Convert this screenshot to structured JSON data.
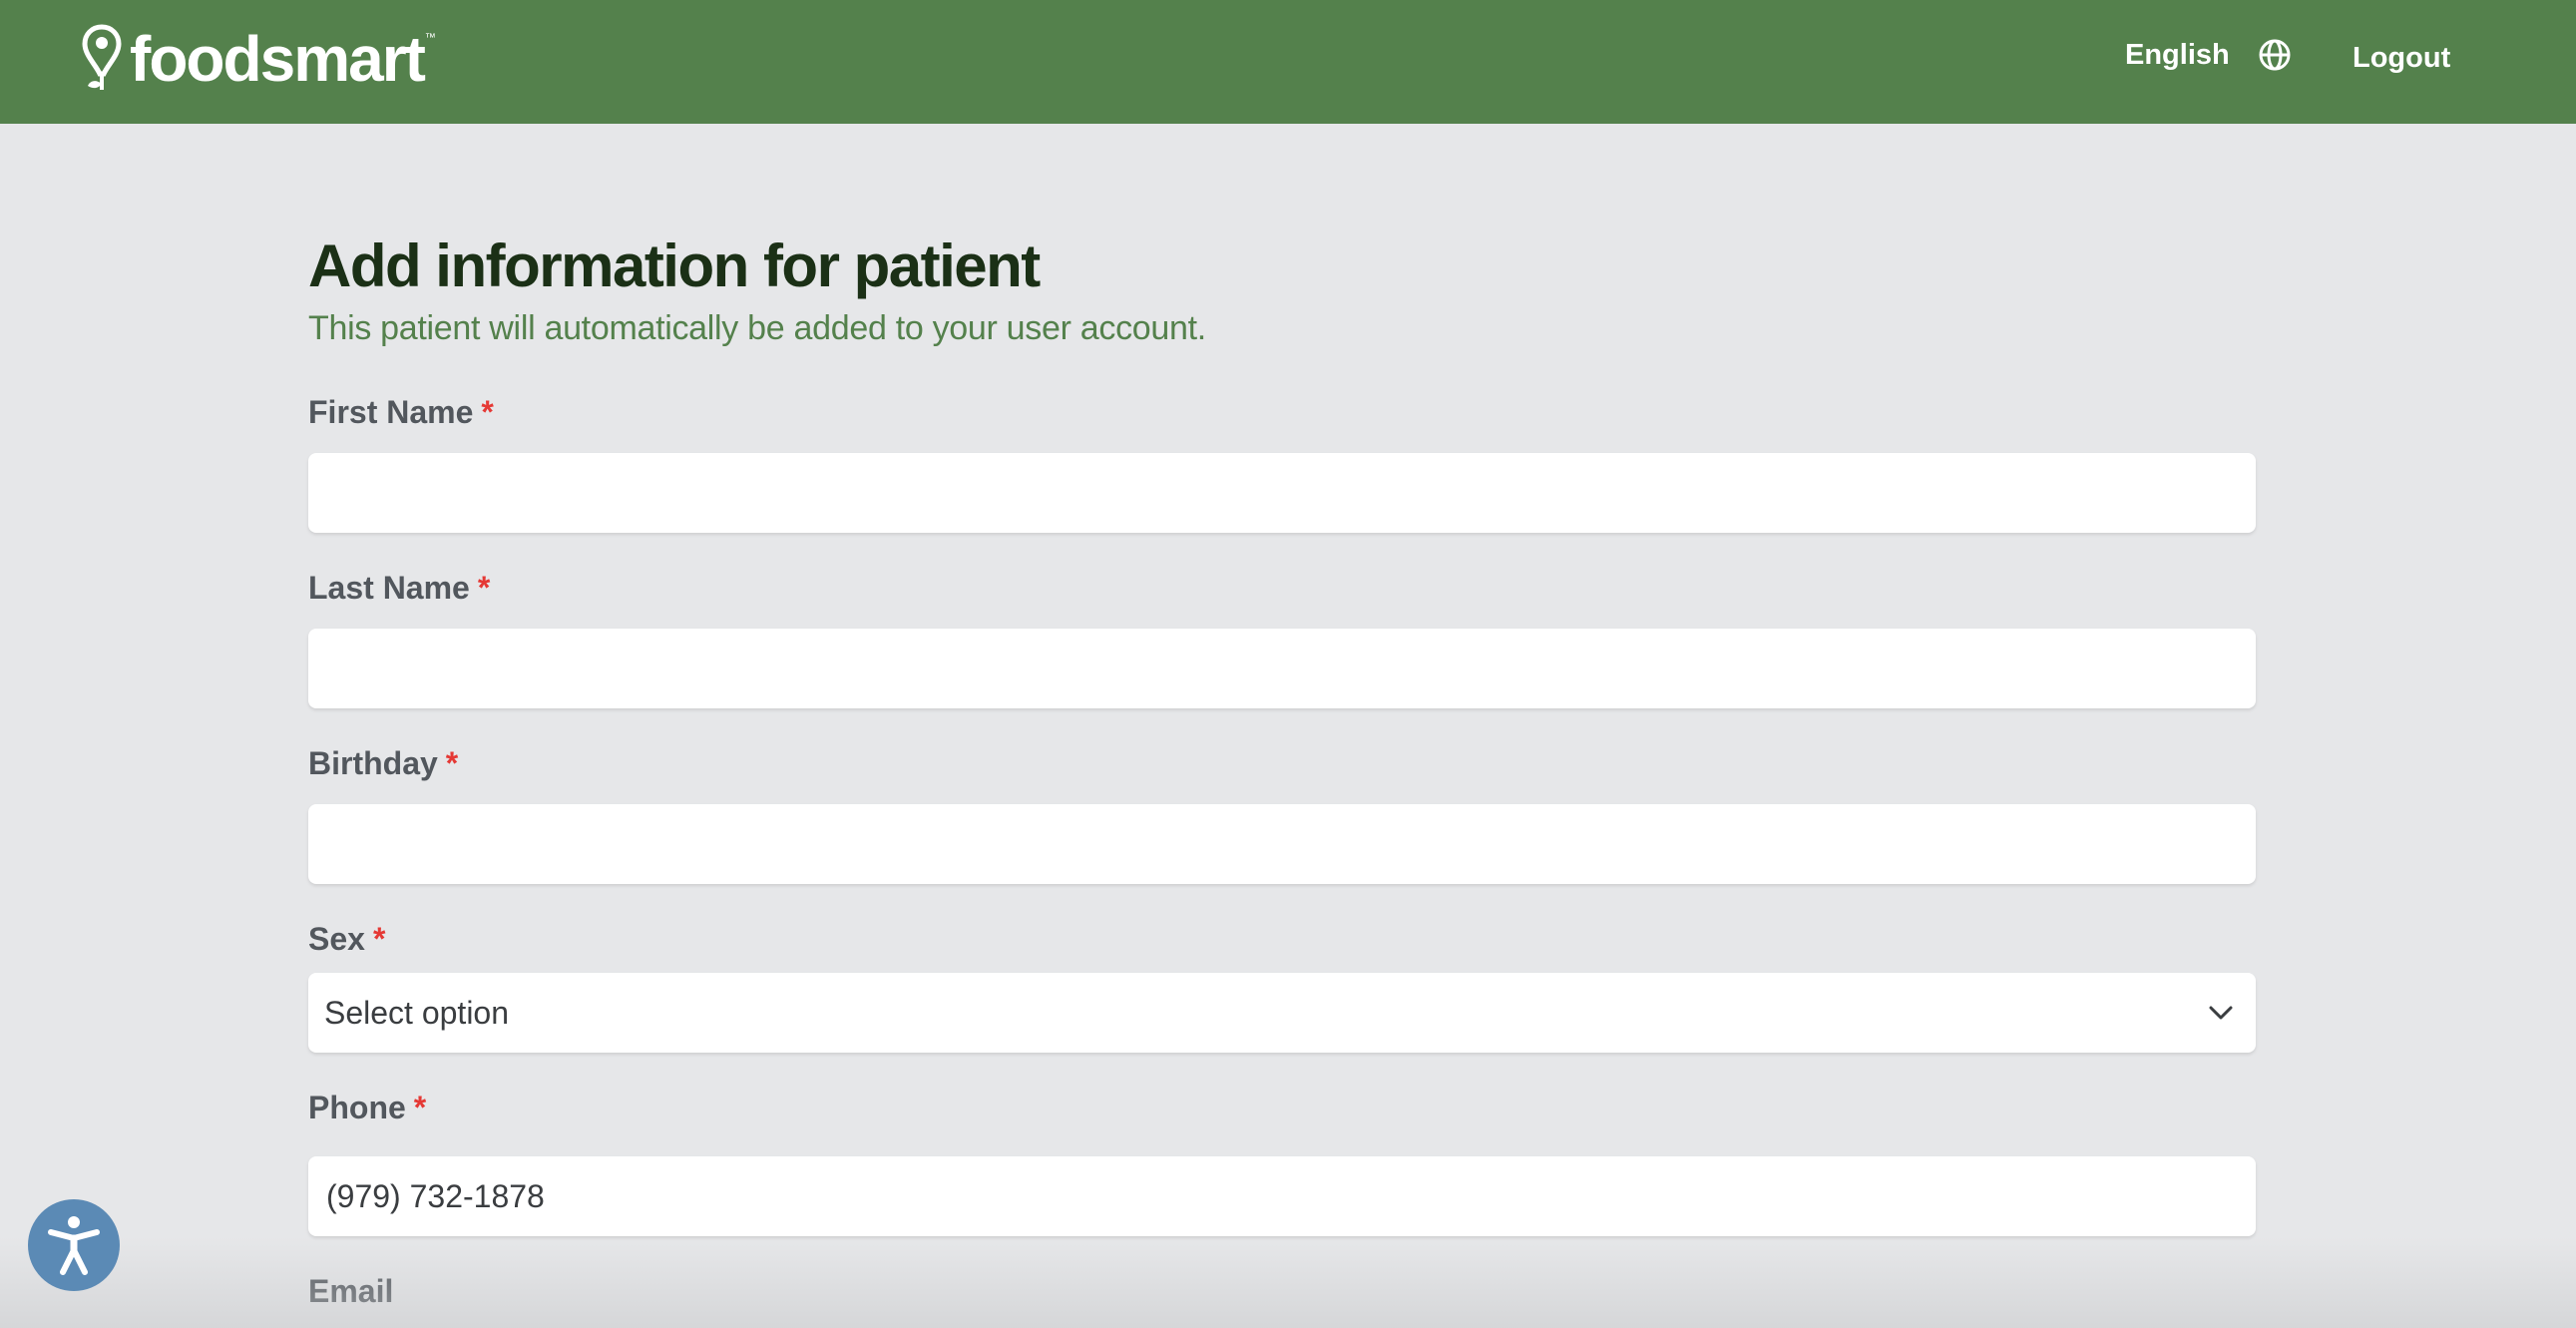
{
  "header": {
    "logo_text": "foodsmart",
    "logo_tm": "™",
    "language_label": "English",
    "logout_label": "Logout"
  },
  "page": {
    "title": "Add information for patient",
    "subtitle": "This patient will automatically be added to your user account."
  },
  "form": {
    "required_marker": "*",
    "first_name": {
      "label": "First Name",
      "value": "",
      "placeholder": ""
    },
    "last_name": {
      "label": "Last Name",
      "value": "",
      "placeholder": ""
    },
    "birthday": {
      "label": "Birthday",
      "value": "",
      "placeholder": ""
    },
    "sex": {
      "label": "Sex",
      "selected": "Select option"
    },
    "phone": {
      "label": "Phone",
      "value": "(979) 732-1878"
    },
    "email": {
      "label": "Email"
    }
  },
  "icons": {
    "logo": "location-pin-leaf-icon",
    "language": "globe-icon",
    "select": "chevron-down-icon",
    "accessibility": "accessibility-person-icon"
  },
  "colors": {
    "header_bg": "#54814c",
    "page_bg": "#e6e7e9",
    "title": "#1b3016",
    "subtitle": "#54814c",
    "required": "#e53935",
    "accessibility_bg": "#5b8ab5"
  }
}
